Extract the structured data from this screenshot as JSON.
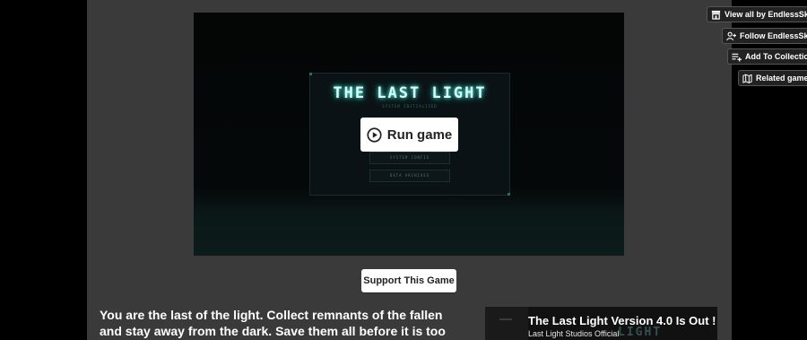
{
  "game": {
    "title": "THE LAST LIGHT",
    "subtitle": "SYSTEM INITIALIZED",
    "menu_options": [
      "SYSTEM CONFIG",
      "DATA ARCHIVES"
    ]
  },
  "run_button": {
    "label": "Run game",
    "icon": "play-circle-icon"
  },
  "support_button": {
    "label": "Support This Game"
  },
  "description": "You are the last of the light. Collect remnants of the fallen and stay away from the dark. Save them all before it is too late...",
  "video": {
    "title": "The Last Light Version 4.0 Is Out !",
    "channel": "Last Light Studios Official",
    "background_text": "LIGHT"
  },
  "side_actions": [
    {
      "label": "View all by EndlessSkys",
      "icon": "store-icon"
    },
    {
      "label": "Follow EndlessSkys",
      "icon": "follow-user-icon"
    },
    {
      "label": "Add To Collection",
      "icon": "add-to-list-icon"
    },
    {
      "label": "Related games",
      "icon": "map-icon"
    }
  ],
  "colors": {
    "page_bg": "#000000",
    "column_bg": "#3a3a3a",
    "title_glow": "#5ff5e8"
  }
}
